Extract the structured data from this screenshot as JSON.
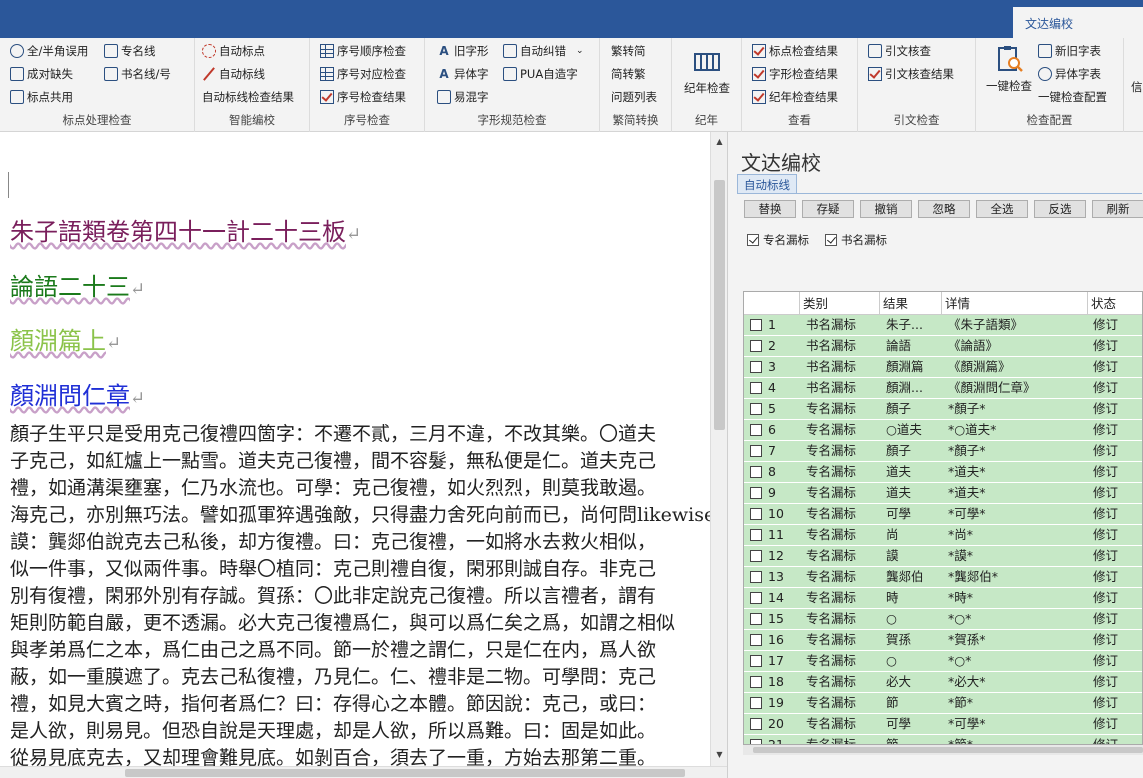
{
  "app": {
    "active_tab": "文达编校"
  },
  "ribbon": {
    "groups": [
      {
        "label": "标点处理检查",
        "items": [
          "全/半角误用",
          "专名线",
          "成对缺失",
          "书名线/号",
          "标点共用"
        ]
      },
      {
        "label": "智能编校",
        "items": [
          "自动标点",
          "自动标线",
          "自动标线检查结果"
        ]
      },
      {
        "label": "序号检查",
        "items": [
          "序号顺序检查",
          "序号对应检查",
          "序号检查结果"
        ]
      },
      {
        "label": "字形规范检查",
        "items": [
          "旧字形",
          "自动纠错",
          "异体字",
          "PUA自造字",
          "易混字"
        ]
      },
      {
        "label": "繁简转换",
        "items": [
          "繁转简",
          "简转繁",
          "问题列表"
        ]
      },
      {
        "label": "纪年",
        "items": [
          "纪年检查"
        ]
      },
      {
        "label": "查看",
        "items": [
          "标点检查结果",
          "字形检查结果",
          "纪年检查结果"
        ]
      },
      {
        "label": "引文检查",
        "items": [
          "引文核查",
          "引文核查结果"
        ]
      },
      {
        "label": "检查配置",
        "items": [
          "一键检查",
          "新旧字表",
          "异体字表",
          "一键检查配置"
        ]
      }
    ],
    "overflow_char": "信"
  },
  "document": {
    "headings": [
      "朱子語類卷第四十一計二十三板",
      "論語二十三",
      "顏淵篇上",
      "顏淵問仁章"
    ],
    "paragraph_mark": "↵",
    "lines": [
      "顏子生平只是受用克己復禮四箇字：不遷不貳，三月不違，不改其樂。〇道夫",
      "子克己，如紅爐上一點雪。道夫克己復禮，間不容髮，無私便是仁。道夫克己",
      "禮，如通溝渠壅塞，仁乃水流也。可學：克己復禮，如火烈烈，則莫我敢遏。",
      "海克己，亦別無巧法。譬如孤軍猝遇強敵，只得盡力舍死向前而已，尚何問likewise",
      "謨：龔郯伯說克去己私後，却方復禮。曰：克己復禮，一如將水去救火相似，",
      "似一件事，又似兩件事。時舉〇植同：克己則禮自復，閑邪則誠自存。非克己",
      "別有復禮，閑邪外別有存誠。賀孫：〇此非定說克己復禮。所以言禮者，謂有",
      "矩則防範自嚴，更不透漏。必大克己復禮爲仁，與可以爲仁矣之爲，如謂之相似",
      "與孝弟爲仁之本，爲仁由己之爲不同。節一於禮之謂仁，只是仁在内，爲人欲",
      "蔽，如一重膜遮了。克去己私復禮，乃見仁。仁、禮非是二物。可學問：克己",
      "禮，如見大賓之時，指何者爲仁？曰：存得心之本體。節因說：克己，或曰：",
      "是人欲，則易見。但恐自說是天理處，却是人欲，所以爲難。曰：固是如此。",
      "從易見底克去，又却理會難見底。如剝百合，須去了一重，方始去那第二重。"
    ]
  },
  "panel": {
    "title": "文达编校",
    "tab": "自动标线",
    "buttons": [
      "替换",
      "存疑",
      "撤销",
      "忽略",
      "全选",
      "反选",
      "刷新"
    ],
    "checks": [
      {
        "label": "专名漏标",
        "checked": true
      },
      {
        "label": "书名漏标",
        "checked": true
      }
    ],
    "columns": [
      "类别",
      "结果",
      "详情",
      "状态"
    ],
    "rows": [
      {
        "n": "1",
        "type": "书名漏标",
        "result": "朱子...",
        "detail": "《朱子語類》",
        "status": "修订"
      },
      {
        "n": "2",
        "type": "书名漏标",
        "result": "論語",
        "detail": "《論語》",
        "status": "修订"
      },
      {
        "n": "3",
        "type": "书名漏标",
        "result": "顏淵篇",
        "detail": "《顏淵篇》",
        "status": "修订"
      },
      {
        "n": "4",
        "type": "书名漏标",
        "result": "顏淵...",
        "detail": "《顏淵問仁章》",
        "status": "修订"
      },
      {
        "n": "5",
        "type": "专名漏标",
        "result": "顏子",
        "detail": "*顏子*",
        "status": "修订"
      },
      {
        "n": "6",
        "type": "专名漏标",
        "result": "○道夫",
        "detail": "*○道夫*",
        "status": "修订"
      },
      {
        "n": "7",
        "type": "专名漏标",
        "result": " 顏子",
        "detail": " *顏子*",
        "status": "修订"
      },
      {
        "n": "8",
        "type": "专名漏标",
        "result": "道夫",
        "detail": "*道夫*",
        "status": "修订"
      },
      {
        "n": "9",
        "type": "专名漏标",
        "result": "道夫",
        "detail": "*道夫*",
        "status": "修订"
      },
      {
        "n": "10",
        "type": "专名漏标",
        "result": "可學",
        "detail": "*可學*",
        "status": "修订"
      },
      {
        "n": "11",
        "type": "专名漏标",
        "result": "尚",
        "detail": "*尚*",
        "status": "修订"
      },
      {
        "n": "12",
        "type": "专名漏标",
        "result": "謨",
        "detail": "*謨*",
        "status": "修订"
      },
      {
        "n": "13",
        "type": "专名漏标",
        "result": "龔郯伯",
        "detail": "*龔郯伯*",
        "status": "修订"
      },
      {
        "n": "14",
        "type": "专名漏标",
        "result": "時",
        "detail": "*時*",
        "status": "修订"
      },
      {
        "n": "15",
        "type": "专名漏标",
        "result": "○",
        "detail": "*○*",
        "status": "修订"
      },
      {
        "n": "16",
        "type": "专名漏标",
        "result": "賀孫",
        "detail": "*賀孫*",
        "status": "修订"
      },
      {
        "n": "17",
        "type": "专名漏标",
        "result": "○",
        "detail": "*○*",
        "status": "修订"
      },
      {
        "n": "18",
        "type": "专名漏标",
        "result": "必大",
        "detail": "*必大*",
        "status": "修订"
      },
      {
        "n": "19",
        "type": "专名漏标",
        "result": "節",
        "detail": "*節*",
        "status": "修订"
      },
      {
        "n": "20",
        "type": "专名漏标",
        "result": "可學",
        "detail": "*可學*",
        "status": "修订"
      },
      {
        "n": "21",
        "type": "专名漏标",
        "result": "節",
        "detail": "*節*",
        "status": "修订"
      }
    ]
  },
  "colors": {
    "brand": "#2b579a",
    "row_bg": "#c6e8c6",
    "accent_red": "#c0392b"
  }
}
